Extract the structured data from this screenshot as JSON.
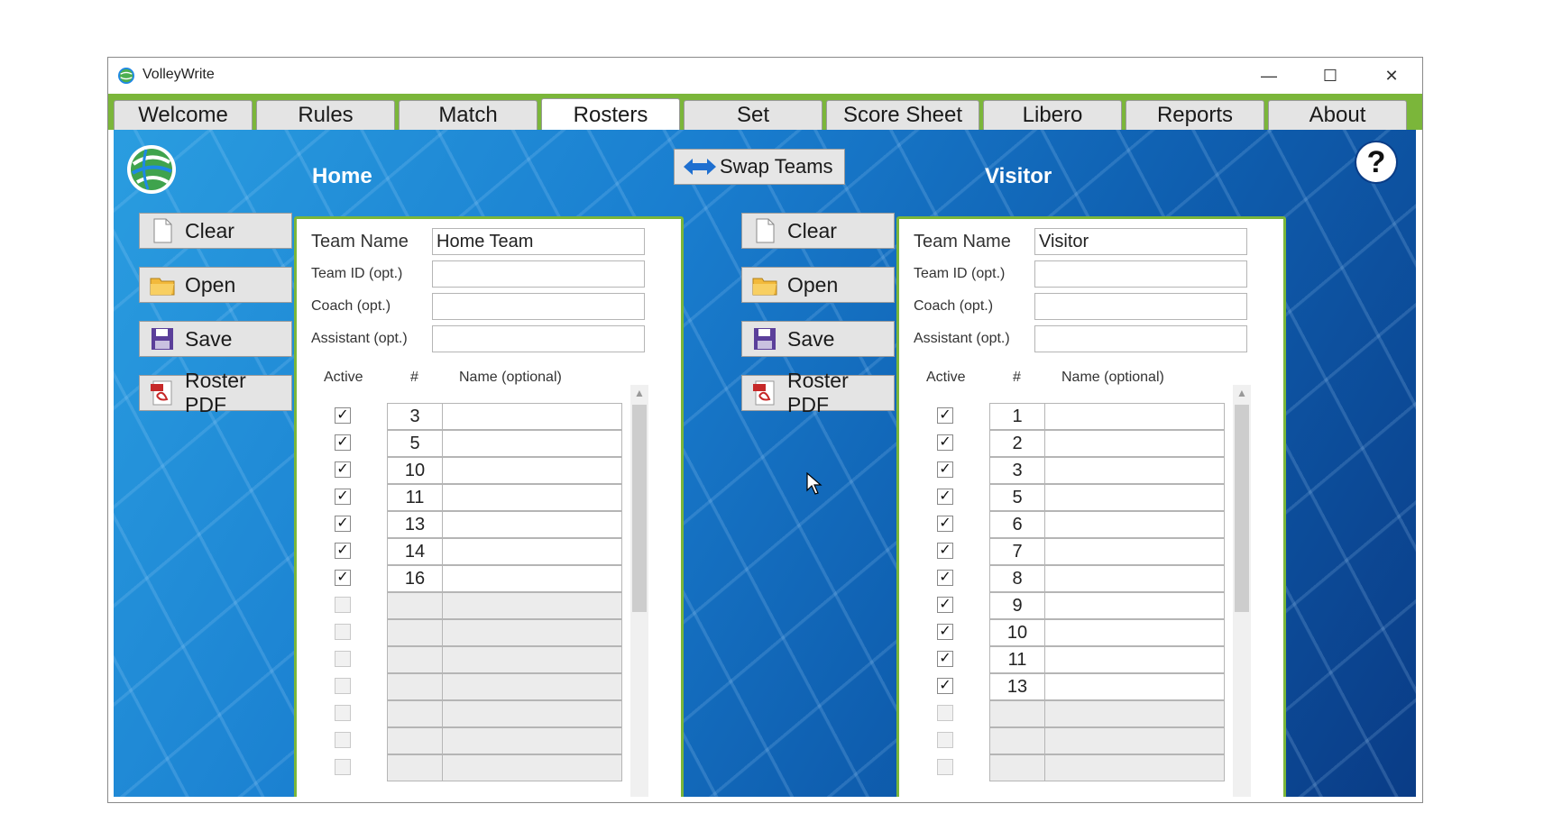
{
  "window": {
    "title": "VolleyWrite",
    "controls": {
      "minimize": "—",
      "maximize": "☐",
      "close": "✕"
    }
  },
  "tabs": [
    {
      "label": "Welcome",
      "active": false
    },
    {
      "label": "Rules",
      "active": false
    },
    {
      "label": "Match",
      "active": false
    },
    {
      "label": "Rosters",
      "active": true
    },
    {
      "label": "Set",
      "active": false
    },
    {
      "label": "Score Sheet",
      "active": false
    },
    {
      "label": "Libero",
      "active": false
    },
    {
      "label": "Reports",
      "active": false
    },
    {
      "label": "About",
      "active": false
    }
  ],
  "toolbar": {
    "swap_label": "Swap Teams",
    "help": "?"
  },
  "home": {
    "title": "Home",
    "buttons": {
      "clear": "Clear",
      "open": "Open",
      "save": "Save",
      "pdf": "Roster PDF"
    },
    "labels": {
      "team_name": "Team Name",
      "team_id": "Team ID (opt.)",
      "coach": "Coach (opt.)",
      "assistant": "Assistant (opt.)"
    },
    "values": {
      "team_name": "Home Team",
      "team_id": "",
      "coach": "",
      "assistant": ""
    },
    "columns": {
      "active": "Active",
      "number": "#",
      "name": "Name (optional)"
    },
    "rows": [
      {
        "active": true,
        "num": "3",
        "name": ""
      },
      {
        "active": true,
        "num": "5",
        "name": ""
      },
      {
        "active": true,
        "num": "10",
        "name": ""
      },
      {
        "active": true,
        "num": "11",
        "name": ""
      },
      {
        "active": true,
        "num": "13",
        "name": ""
      },
      {
        "active": true,
        "num": "14",
        "name": ""
      },
      {
        "active": true,
        "num": "16",
        "name": ""
      },
      {
        "active": false,
        "num": "",
        "name": ""
      },
      {
        "active": false,
        "num": "",
        "name": ""
      },
      {
        "active": false,
        "num": "",
        "name": ""
      },
      {
        "active": false,
        "num": "",
        "name": ""
      },
      {
        "active": false,
        "num": "",
        "name": ""
      },
      {
        "active": false,
        "num": "",
        "name": ""
      },
      {
        "active": false,
        "num": "",
        "name": ""
      }
    ]
  },
  "visitor": {
    "title": "Visitor",
    "buttons": {
      "clear": "Clear",
      "open": "Open",
      "save": "Save",
      "pdf": "Roster PDF"
    },
    "labels": {
      "team_name": "Team Name",
      "team_id": "Team ID (opt.)",
      "coach": "Coach (opt.)",
      "assistant": "Assistant (opt.)"
    },
    "values": {
      "team_name": "Visitor",
      "team_id": "",
      "coach": "",
      "assistant": ""
    },
    "columns": {
      "active": "Active",
      "number": "#",
      "name": "Name (optional)"
    },
    "rows": [
      {
        "active": true,
        "num": "1",
        "name": ""
      },
      {
        "active": true,
        "num": "2",
        "name": ""
      },
      {
        "active": true,
        "num": "3",
        "name": ""
      },
      {
        "active": true,
        "num": "5",
        "name": ""
      },
      {
        "active": true,
        "num": "6",
        "name": ""
      },
      {
        "active": true,
        "num": "7",
        "name": ""
      },
      {
        "active": true,
        "num": "8",
        "name": ""
      },
      {
        "active": true,
        "num": "9",
        "name": ""
      },
      {
        "active": true,
        "num": "10",
        "name": ""
      },
      {
        "active": true,
        "num": "11",
        "name": ""
      },
      {
        "active": true,
        "num": "13",
        "name": ""
      },
      {
        "active": false,
        "num": "",
        "name": ""
      },
      {
        "active": false,
        "num": "",
        "name": ""
      },
      {
        "active": false,
        "num": "",
        "name": ""
      }
    ]
  },
  "colors": {
    "tab_strip": "#7bb63a",
    "panel_border": "#7bb63a",
    "bg_light": "#2a9de0",
    "bg_dark": "#0a3c86"
  }
}
